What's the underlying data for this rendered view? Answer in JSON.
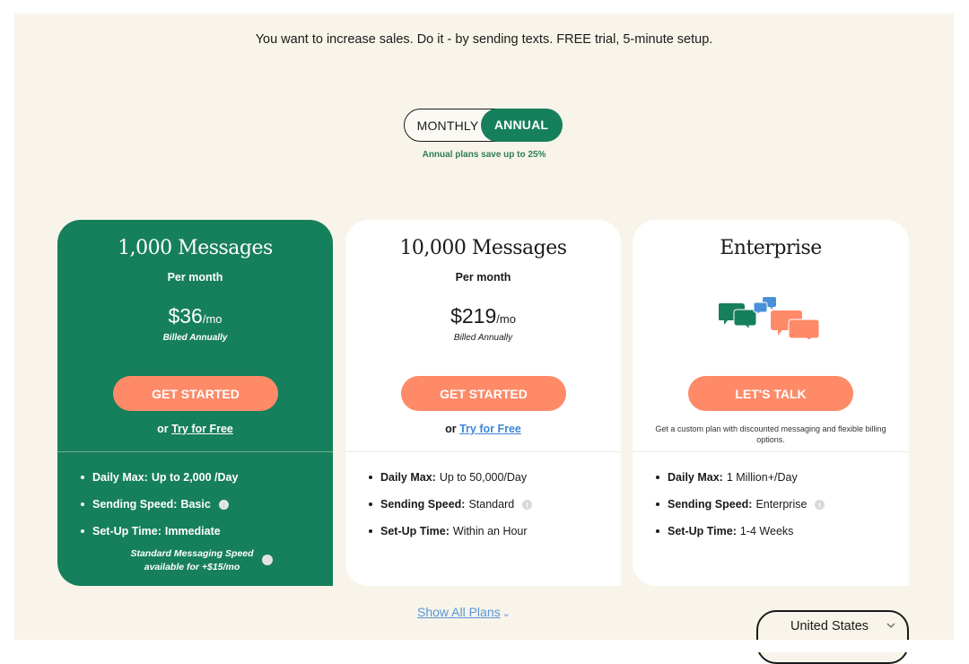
{
  "header": {
    "tagline": "You want to increase sales. Do it - by sending texts. FREE trial, 5-minute setup."
  },
  "billing_toggle": {
    "options": [
      "MONTHLY",
      "ANNUAL"
    ],
    "selected": "ANNUAL",
    "note": "Annual plans save up to 25%"
  },
  "colors": {
    "brand_green": "#167f5c",
    "cta_orange": "#fe8a68",
    "link_blue": "#3d87d5",
    "background": "#f8f4ea"
  },
  "plans": [
    {
      "title": "1,000 Messages",
      "period": "Per month",
      "price": "$36",
      "price_unit": "/mo",
      "billing": "Billed Annually",
      "cta": "GET STARTED",
      "try_prefix": "or",
      "try_link": "Try for Free",
      "features": [
        {
          "label": "Daily Max:",
          "value": "Up to 2,000 /Day",
          "info": false
        },
        {
          "label": "Sending Speed:",
          "value": "Basic",
          "info": true
        },
        {
          "label": "Set-Up Time:",
          "value": "Immediate",
          "info": false
        }
      ],
      "addon": "Standard Messaging Speed available for +$15/mo",
      "highlighted": true
    },
    {
      "title": "10,000 Messages",
      "period": "Per month",
      "price": "$219",
      "price_unit": "/mo",
      "billing": "Billed Annually",
      "cta": "GET STARTED",
      "try_prefix": "or",
      "try_link": "Try for Free",
      "features": [
        {
          "label": "Daily Max:",
          "value": "Up to 50,000/Day",
          "info": false
        },
        {
          "label": "Sending Speed:",
          "value": "Standard",
          "info": true
        },
        {
          "label": "Set-Up Time:",
          "value": "Within an Hour",
          "info": false
        }
      ]
    },
    {
      "title": "Enterprise",
      "icon": "chat-bubbles-icon",
      "cta": "LET'S TALK",
      "note": "Get a custom plan with discounted messaging and flexible billing options.",
      "features": [
        {
          "label": "Daily Max:",
          "value": "1 Million+/Day",
          "info": false
        },
        {
          "label": "Sending Speed:",
          "value": "Enterprise",
          "info": true
        },
        {
          "label": "Set-Up Time:",
          "value": "1-4 Weeks",
          "info": false
        }
      ]
    }
  ],
  "footer": {
    "show_all": "Show All Plans",
    "country": "United States"
  }
}
